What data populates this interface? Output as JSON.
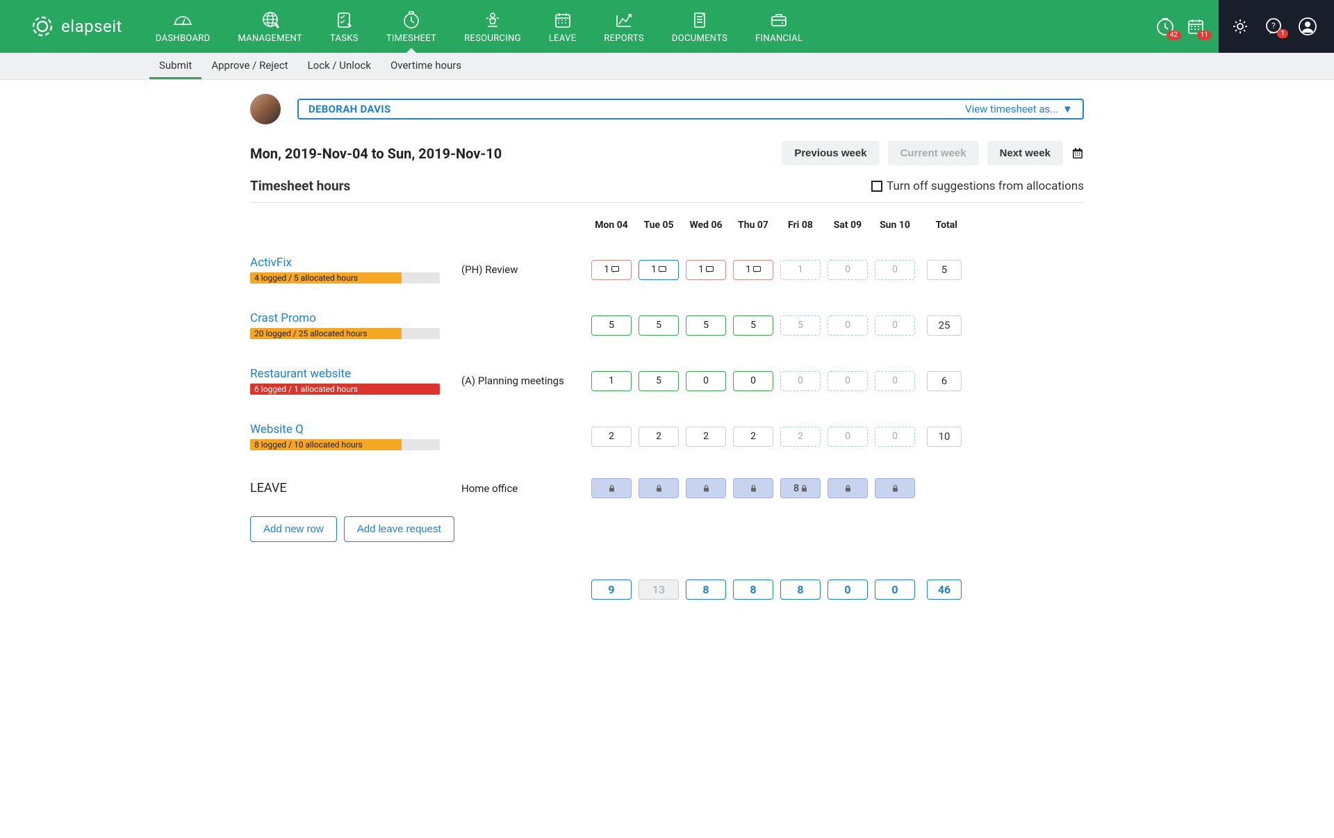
{
  "brand": "elapseit",
  "nav": [
    "DASHBOARD",
    "MANAGEMENT",
    "TASKS",
    "TIMESHEET",
    "RESOURCING",
    "LEAVE",
    "REPORTS",
    "DOCUMENTS",
    "FINANCIAL"
  ],
  "active_nav": 3,
  "notif": {
    "timer_badge": "42",
    "cal_badge": "11",
    "chat_badge": "1"
  },
  "subnav": [
    "Submit",
    "Approve / Reject",
    "Lock / Unlock",
    "Overtime hours"
  ],
  "active_subnav": 0,
  "user": {
    "name": "DEBORAH DAVIS",
    "view_as": "View timesheet as..."
  },
  "week": {
    "range": "Mon, 2019-Nov-04 to Sun, 2019-Nov-10",
    "prev": "Previous week",
    "current": "Current week",
    "next": "Next week"
  },
  "section_title": "Timesheet hours",
  "suggestion_label": "Turn off suggestions from allocations",
  "days": [
    "Mon 04",
    "Tue 05",
    "Wed 06",
    "Thu 07",
    "Fri 08",
    "Sat 09",
    "Sun 10"
  ],
  "total_label": "Total",
  "rows": [
    {
      "project": "ActivFix",
      "bar_text": "4 logged / 5 allocated hours",
      "bar_pct": 80,
      "bar_over": false,
      "task": "(PH) Review",
      "cells": [
        {
          "v": "1",
          "style": "red",
          "comment": true
        },
        {
          "v": "1",
          "style": "blue",
          "comment": true
        },
        {
          "v": "1",
          "style": "red",
          "comment": true
        },
        {
          "v": "1",
          "style": "red",
          "comment": true
        },
        {
          "v": "1",
          "style": "dashed"
        },
        {
          "v": "0",
          "style": "dashed"
        },
        {
          "v": "0",
          "style": "dashed"
        }
      ],
      "total": "5"
    },
    {
      "project": "Crast Promo",
      "bar_text": "20 logged / 25 allocated hours",
      "bar_pct": 80,
      "bar_over": false,
      "task": "",
      "cells": [
        {
          "v": "5",
          "style": "green"
        },
        {
          "v": "5",
          "style": "green"
        },
        {
          "v": "5",
          "style": "green"
        },
        {
          "v": "5",
          "style": "green"
        },
        {
          "v": "5",
          "style": "dashed"
        },
        {
          "v": "0",
          "style": "dashed"
        },
        {
          "v": "0",
          "style": "dashed"
        }
      ],
      "total": "25"
    },
    {
      "project": "Restaurant website",
      "bar_text": "6 logged / 1 allocated hours",
      "bar_pct": 100,
      "bar_over": true,
      "task": "(A) Planning meetings",
      "cells": [
        {
          "v": "1",
          "style": "green"
        },
        {
          "v": "5",
          "style": "green"
        },
        {
          "v": "0",
          "style": "green"
        },
        {
          "v": "0",
          "style": "green"
        },
        {
          "v": "0",
          "style": "dashed"
        },
        {
          "v": "0",
          "style": "dashed"
        },
        {
          "v": "0",
          "style": "dashed"
        }
      ],
      "total": "6"
    },
    {
      "project": "Website Q",
      "bar_text": "8 logged / 10 allocated hours",
      "bar_pct": 80,
      "bar_over": false,
      "task": "",
      "cells": [
        {
          "v": "2",
          "style": "gray"
        },
        {
          "v": "2",
          "style": "gray"
        },
        {
          "v": "2",
          "style": "gray"
        },
        {
          "v": "2",
          "style": "gray"
        },
        {
          "v": "2",
          "style": "dashed"
        },
        {
          "v": "0",
          "style": "dashed"
        },
        {
          "v": "0",
          "style": "dashed"
        }
      ],
      "total": "10"
    }
  ],
  "leave": {
    "label": "LEAVE",
    "task": "Home office",
    "cells": [
      {
        "lock": true
      },
      {
        "lock": true
      },
      {
        "lock": true
      },
      {
        "lock": true
      },
      {
        "v": "8",
        "lock": true
      },
      {
        "lock": true
      },
      {
        "lock": true
      }
    ]
  },
  "actions": {
    "add_row": "Add new row",
    "add_leave": "Add leave request"
  },
  "totals": {
    "days": [
      "9",
      "13",
      "8",
      "8",
      "8",
      "0",
      "0"
    ],
    "dim_index": 1,
    "grand": "46"
  }
}
